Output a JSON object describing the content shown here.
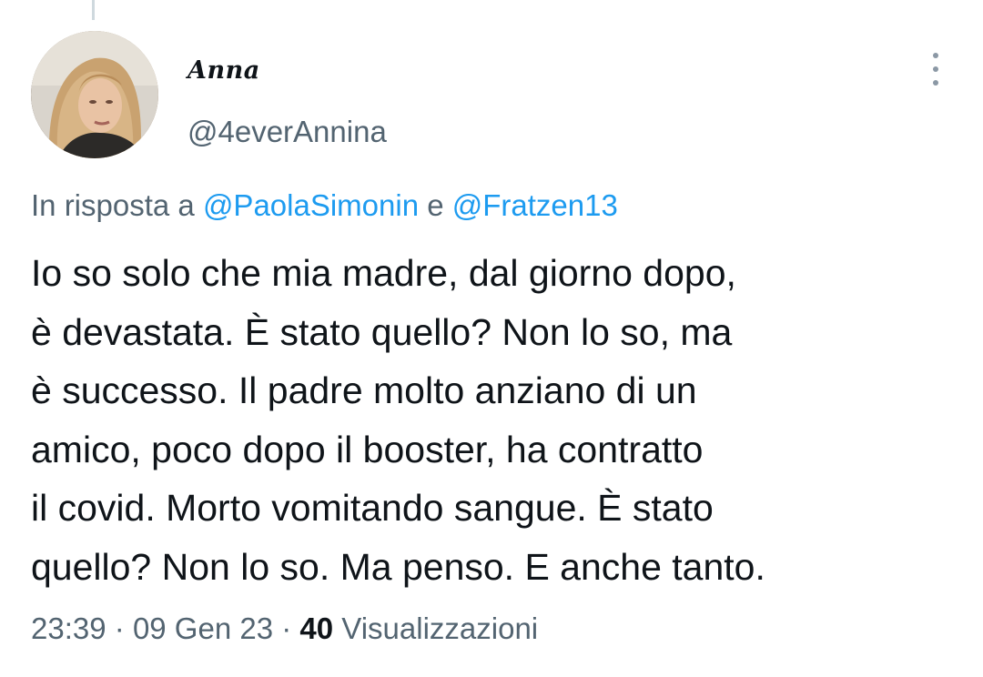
{
  "author": {
    "display_name": "Anna",
    "handle": "@4everAnnina"
  },
  "reply": {
    "prefix": "In risposta a",
    "mentions": [
      "@PaolaSimonin",
      "@Fratzen13"
    ],
    "conjunction": "e"
  },
  "tweet": {
    "lines": [
      "Io so solo che mia madre, dal giorno dopo,",
      "è devastata. È stato quello? Non lo so, ma",
      "è successo. Il padre molto anziano di un",
      "amico, poco dopo il booster, ha contratto",
      "il covid. Morto vomitando sangue. È stato",
      "quello? Non lo so. Ma penso. E anche tanto."
    ]
  },
  "meta": {
    "time": "23:39",
    "separator": "·",
    "date": "09 Gen 23",
    "views_count": "40",
    "views_label": "Visualizzazioni"
  },
  "icons": {
    "more": "more-vertical-icon"
  },
  "colors": {
    "link": "#1d9bf0",
    "secondary_text": "#536471",
    "primary_text": "#0f1419"
  }
}
